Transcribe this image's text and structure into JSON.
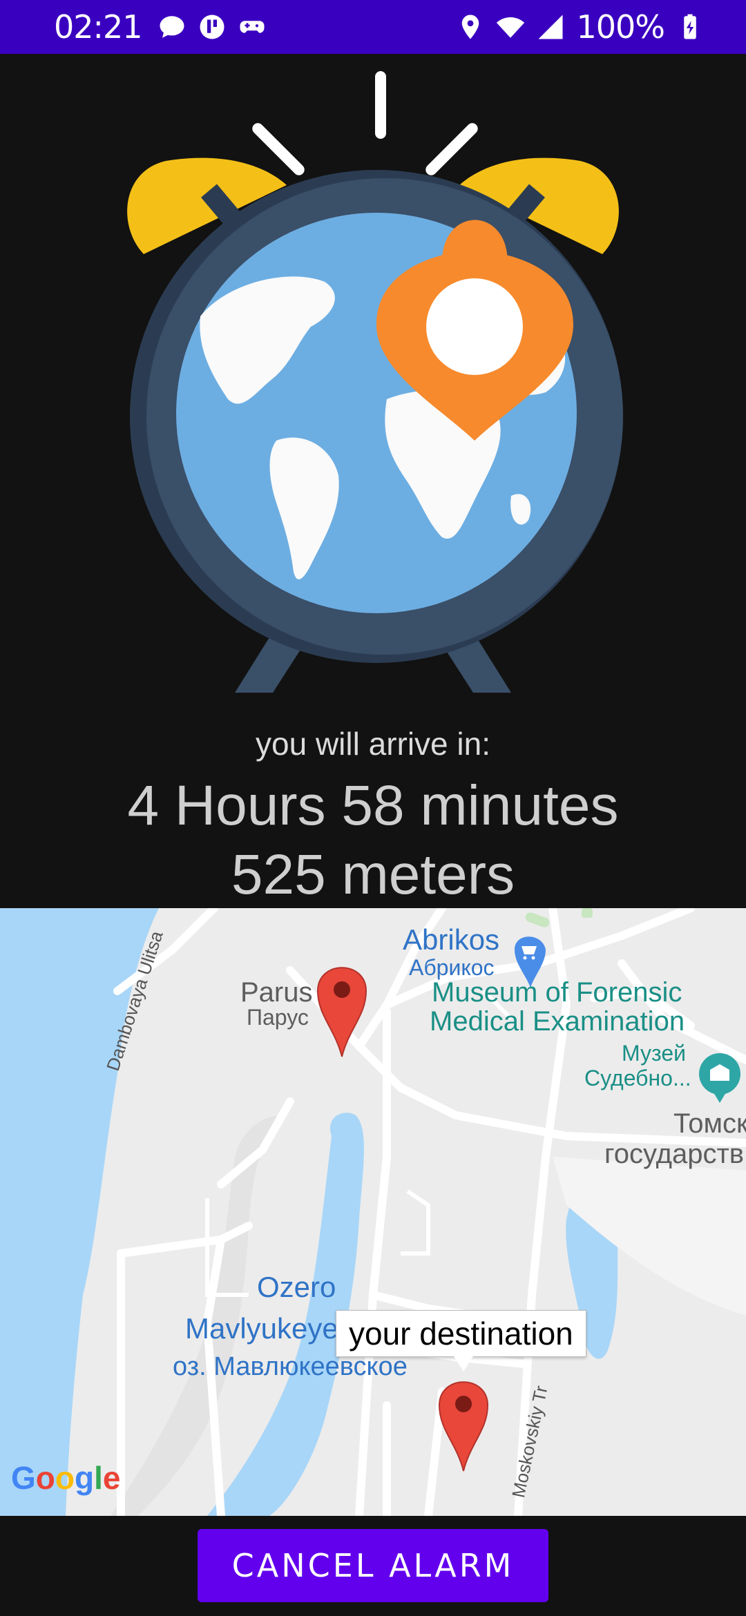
{
  "status_bar": {
    "time": "02:21",
    "battery": "100%",
    "left_icons": [
      "chat-icon",
      "app-badge-icon",
      "game-controller-icon"
    ],
    "right_icons": [
      "location-icon",
      "wifi-icon",
      "signal-icon",
      "battery-charging-icon"
    ]
  },
  "illustration": {
    "name": "alarm-clock-globe",
    "colors": {
      "bell": "#f4c018",
      "clock": "#3a4f68",
      "globe": "#6daee2",
      "pin": "#f78a2c"
    }
  },
  "arrival": {
    "label": "you will arrive in:",
    "time": "4 Hours 58 minutes",
    "distance": "525 meters"
  },
  "map": {
    "labels": {
      "abrikos_en": "Abrikos",
      "abrikos_ru": "Абрикос",
      "parus_en": "Parus",
      "parus_ru": "Парус",
      "museum_line1": "Museum of Forensic",
      "museum_line2": "Medical Examination",
      "museum_ru1": "Музей",
      "museum_ru2": "Судебно...",
      "tomsk1": "Томск",
      "tomsk2": "государств",
      "dambovaya": "Dambovaya Ulitsa",
      "ozero1": "Ozero",
      "ozero2": "Mavlyukeyev",
      "ozero_ru": "оз. Мавлюкеевское",
      "moskovsky": "Moskovskiy Tr",
      "google": "Google"
    },
    "destination_label": "your destination",
    "colors": {
      "water": "#a8d6f8",
      "land": "#ececec",
      "road": "#ffffff",
      "pin": "#e8473a"
    }
  },
  "actions": {
    "cancel_label": "CANCEL ALARM"
  }
}
